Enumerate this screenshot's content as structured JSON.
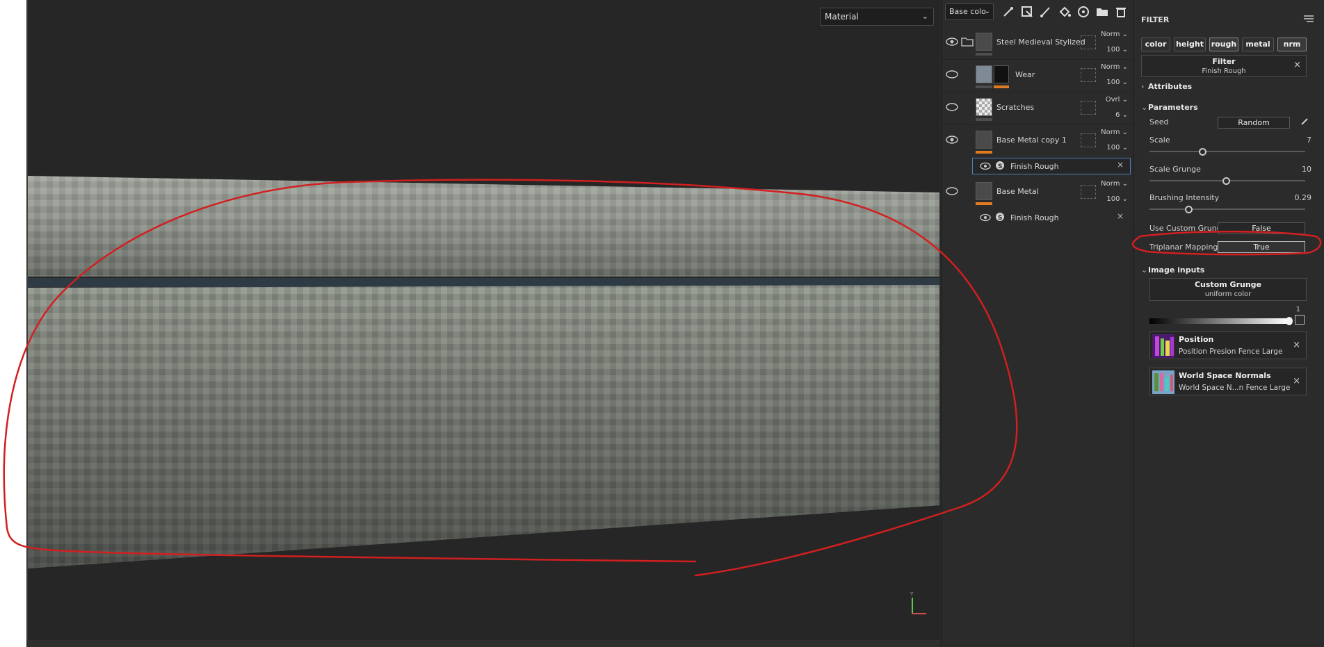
{
  "viewport": {
    "material_select": "Material"
  },
  "layers_panel": {
    "channel_select": "Base colo",
    "tools": [
      "magic-wand-icon",
      "add-mask-icon",
      "brush-icon",
      "fill-icon",
      "smart-material-icon",
      "folder-icon",
      "trash-icon"
    ],
    "layers": [
      {
        "name": "Steel Medieval Stylized",
        "blend": "Norm",
        "opacity": "100",
        "visible": true,
        "is_folder": true
      },
      {
        "name": "Wear",
        "blend": "Norm",
        "opacity": "100",
        "visible": false,
        "has_mask": true
      },
      {
        "name": "Scratches",
        "blend": "Ovrl",
        "opacity": "6",
        "visible": false
      },
      {
        "name": "Base Metal copy 1",
        "blend": "Norm",
        "opacity": "100",
        "visible": true
      },
      {
        "name": "Base Metal",
        "blend": "Norm",
        "opacity": "100",
        "visible": false
      }
    ],
    "effects": [
      {
        "name": "Finish Rough",
        "selected": true
      },
      {
        "name": "Finish Rough",
        "selected": false
      }
    ]
  },
  "properties": {
    "title": "FILTER",
    "channel_tabs": [
      {
        "label": "color",
        "active": false
      },
      {
        "label": "height",
        "active": false
      },
      {
        "label": "rough",
        "active": true
      },
      {
        "label": "metal",
        "active": false
      },
      {
        "label": "nrm",
        "active": true
      }
    ],
    "filter_box": {
      "title": "Filter",
      "name": "Finish Rough"
    },
    "sections": {
      "attributes": "Attributes",
      "parameters": "Parameters",
      "image_inputs": "Image inputs"
    },
    "seed": {
      "label": "Seed",
      "value": "Random"
    },
    "scale": {
      "label": "Scale",
      "value": "7",
      "fraction": 0.34
    },
    "scale_grunge": {
      "label": "Scale Grunge",
      "value": "10",
      "fraction": 0.49
    },
    "brushing_intensity": {
      "label": "Brushing Intensity",
      "value": "0.29",
      "fraction": 0.25
    },
    "use_custom_grunge": {
      "label": "Use Custom Grunge",
      "value": "False"
    },
    "triplanar_mapping": {
      "label": "Triplanar Mapping",
      "value": "True"
    },
    "custom_grunge": {
      "title": "Custom Grunge",
      "value": "uniform color",
      "level": "1"
    },
    "inputs": [
      {
        "title": "Position",
        "source": "Position Presion Fence Large"
      },
      {
        "title": "World Space Normals",
        "source": "World Space N...n Fence Large"
      }
    ]
  },
  "colors": {
    "annotation": "#d21f1f",
    "accent_orange": "#e07b22",
    "selection_blue": "#4a7fc1"
  }
}
